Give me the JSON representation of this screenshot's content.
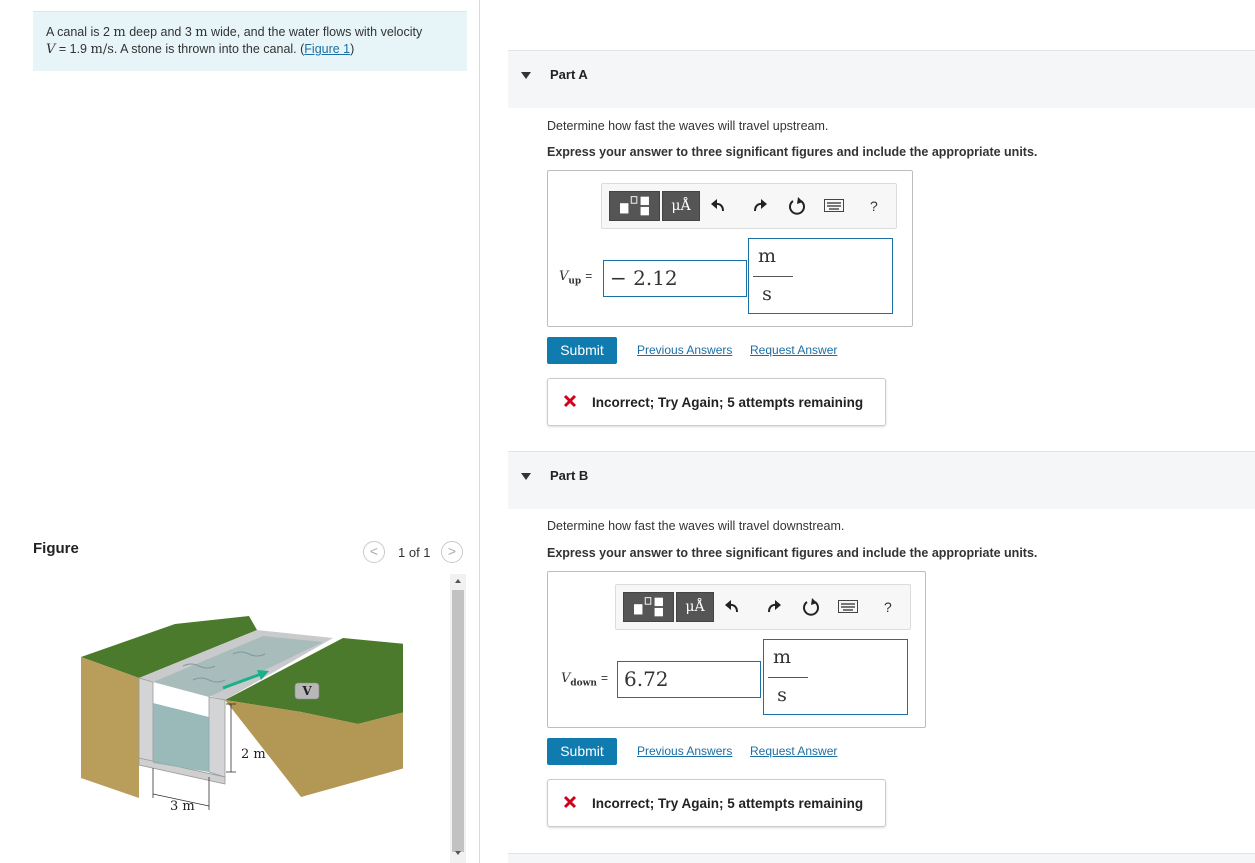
{
  "problem": {
    "text_1": "A canal is 2 ",
    "m_1": "m",
    "text_2": " deep and 3 ",
    "m_2": "m",
    "text_3": " wide, and the water flows with velocity",
    "v_symbol": "V",
    "text_4": " = 1.9 ",
    "unit_mps": "m/s",
    "text_5": ". A stone is thrown into the canal. (",
    "figure_link": "Figure 1",
    "text_6": ")"
  },
  "figure": {
    "title": "Figure",
    "prev_glyph": "<",
    "count": "1 of 1",
    "next_glyph": ">",
    "label_V": "V",
    "label_depth": "2 m",
    "label_width": "3 m"
  },
  "parts": [
    {
      "title": "Part A",
      "question": "Determine how fast the waves will travel upstream.",
      "instruction": "Express your answer to three significant figures and include the appropriate units.",
      "var_symbol": "V",
      "var_sub": "up",
      "equals": "=",
      "value": "− 2.12",
      "unit_num": "m",
      "unit_den": "s",
      "units_button": "μÅ",
      "help": "?",
      "submit": "Submit",
      "previous_answers": "Previous Answers",
      "request_answer": "Request Answer",
      "feedback": "Incorrect; Try Again; 5 attempts remaining"
    },
    {
      "title": "Part B",
      "question": "Determine how fast the waves will travel downstream.",
      "instruction": "Express your answer to three significant figures and include the appropriate units.",
      "var_symbol": "V",
      "var_sub": "down",
      "equals": "=",
      "value": "6.72",
      "unit_num": "m",
      "unit_den": "s",
      "units_button": "μÅ",
      "help": "?",
      "submit": "Submit",
      "previous_answers": "Previous Answers",
      "request_answer": "Request Answer",
      "feedback": "Incorrect; Try Again; 5 attempts remaining"
    }
  ],
  "colors": {
    "problem_bg": "#e7f5f8",
    "link": "#1a6fa5",
    "submit_bg": "#0f7baf",
    "error": "#d0021b",
    "toolbar_dark": "#555555"
  },
  "icons": {
    "part_toggle": "triangle-down-icon",
    "templates": "templates-icon",
    "undo": "undo-icon",
    "redo": "redo-icon",
    "reset": "reset-icon",
    "keyboard": "keyboard-icon",
    "feedback": "x-mark-icon"
  }
}
